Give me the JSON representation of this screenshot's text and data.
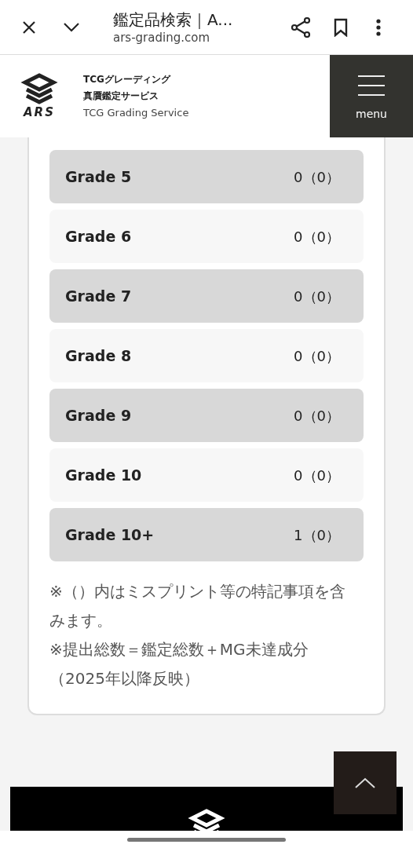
{
  "browser_bar": {
    "title": "鑑定品検索｜A...",
    "url": "ars-grading.com"
  },
  "site_header": {
    "logo_text": "ARS",
    "tagline_lines": [
      "TCGグレーディング",
      "真贋鑑定サービス"
    ],
    "subtitle": "TCG Grading Service",
    "menu_label": "menu"
  },
  "grades": [
    {
      "label": "Grade 5",
      "count": "0（0）",
      "shaded": true
    },
    {
      "label": "Grade 6",
      "count": "0（0）",
      "shaded": false
    },
    {
      "label": "Grade 7",
      "count": "0（0）",
      "shaded": true
    },
    {
      "label": "Grade 8",
      "count": "0（0）",
      "shaded": false
    },
    {
      "label": "Grade 9",
      "count": "0（0）",
      "shaded": true
    },
    {
      "label": "Grade 10",
      "count": "0（0）",
      "shaded": false
    },
    {
      "label": "Grade 10+",
      "count": "1（0）",
      "shaded": true
    }
  ],
  "notes": [
    "※（）内はミスプリント等の特記事項を含みます。",
    "※提出総数＝鑑定総数＋MG未達成分（2025年以降反映）"
  ]
}
